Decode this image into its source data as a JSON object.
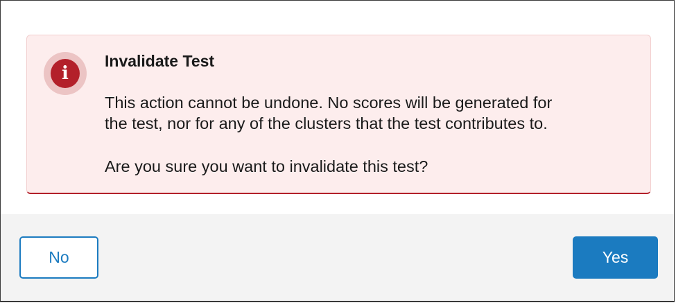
{
  "alert": {
    "icon": "info-icon",
    "icon_glyph": "i",
    "title": "Invalidate Test",
    "body_line1": "This action cannot be undone. No scores will be generated for",
    "body_line2": "the test, nor for any of the clusters that the test contributes to.",
    "question": "Are you sure you want to invalidate this test?"
  },
  "actions": {
    "no_label": "No",
    "yes_label": "Yes"
  },
  "colors": {
    "alert_background": "#fdeded",
    "alert_accent": "#b3202a",
    "primary": "#1b7bc0"
  }
}
